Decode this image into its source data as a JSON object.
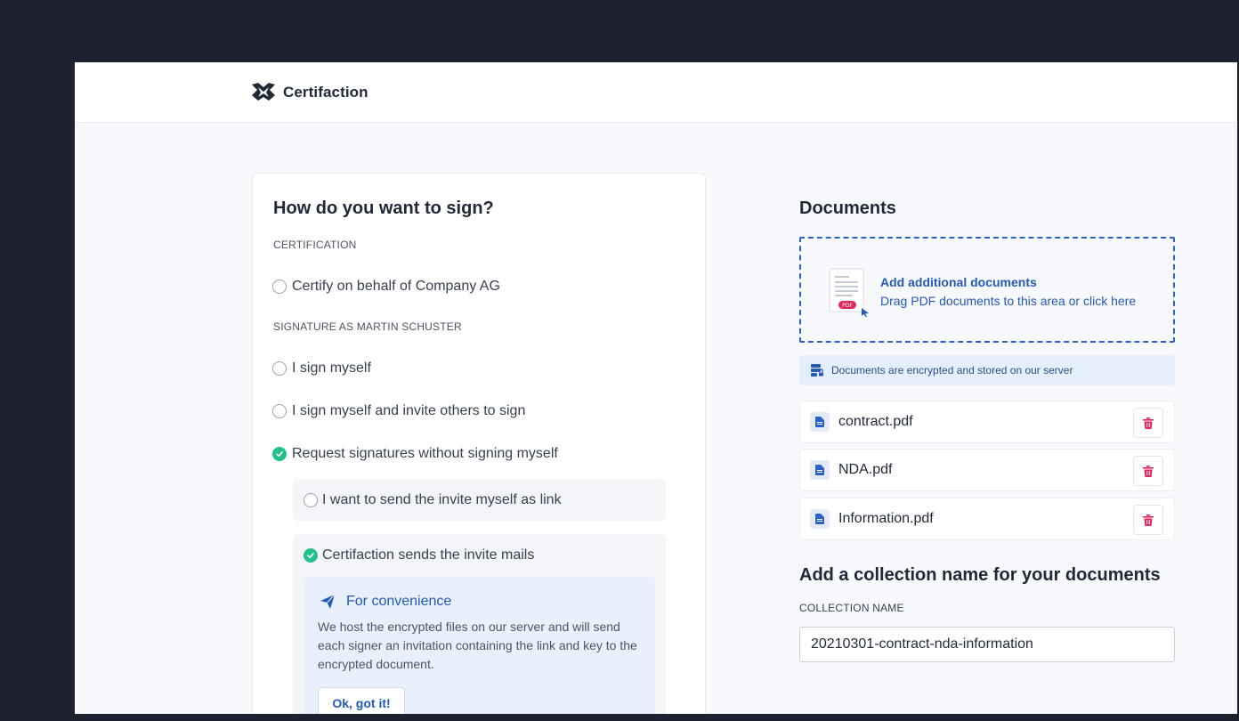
{
  "app": {
    "name": "Certifaction"
  },
  "sign": {
    "title": "How do you want to sign?",
    "certification_label": "CERTIFICATION",
    "certify_option": "Certify on behalf of Company AG",
    "signature_label": "SIGNATURE AS MARTIN SCHUSTER",
    "options": [
      {
        "label": "I sign myself",
        "selected": false
      },
      {
        "label": "I sign myself and invite others to sign",
        "selected": false
      },
      {
        "label": "Request signatures without signing myself",
        "selected": true
      }
    ],
    "sub_options": [
      {
        "label": "I want to send the invite myself as link",
        "selected": false
      },
      {
        "label": "Certifaction sends the invite mails",
        "selected": true
      }
    ],
    "convenience": {
      "title": "For convenience",
      "text": "We host the encrypted files on our server and will send each signer an invitation containing the link and key to the encrypted document.",
      "button": "Ok, got it!"
    }
  },
  "documents": {
    "title": "Documents",
    "dropzone_title": "Add additional documents",
    "dropzone_sub": "Drag PDF documents to this area or click here",
    "pdf_badge": "PDF",
    "encryption_note": "Documents are encrypted and stored on our server",
    "files": [
      "contract.pdf",
      "NDA.pdf",
      "Information.pdf"
    ]
  },
  "collection": {
    "title": "Add a collection name for your documents",
    "label": "COLLECTION NAME",
    "value": "20210301-contract-nda-information"
  },
  "colors": {
    "accent": "#2459b8",
    "success": "#22c08a",
    "danger": "#e0245e",
    "frame": "#1e2230"
  }
}
